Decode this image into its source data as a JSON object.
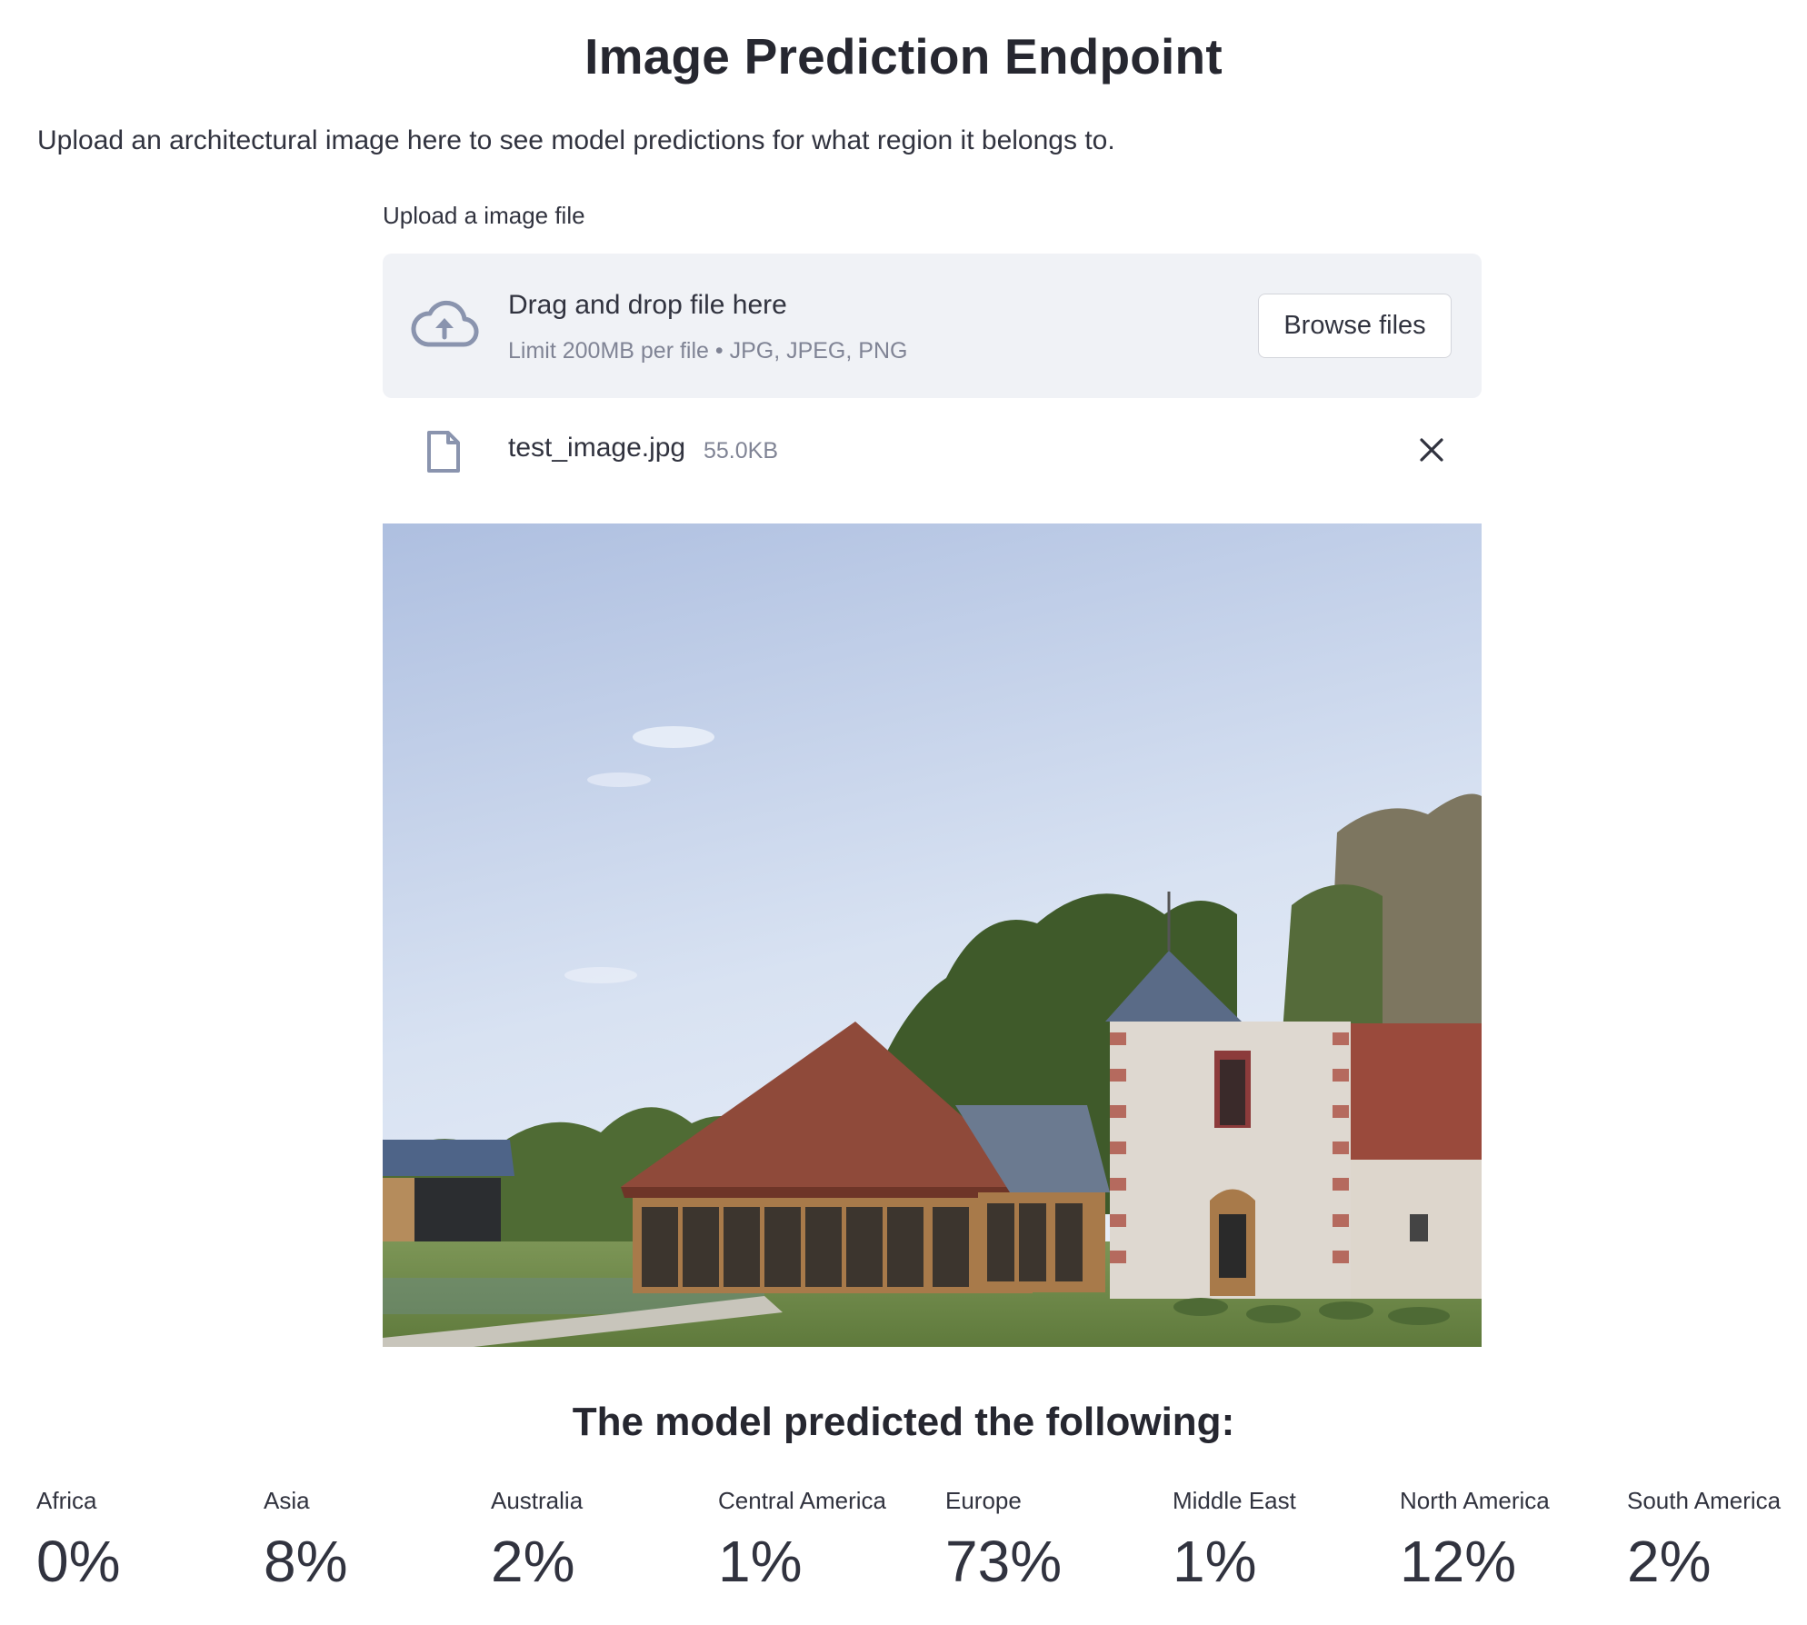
{
  "page": {
    "title": "Image Prediction Endpoint",
    "intro": "Upload an architectural image here to see model predictions for what region it belongs to."
  },
  "uploader": {
    "label": "Upload a image file",
    "drag_text": "Drag and drop file here",
    "limit_text": "Limit 200MB per file • JPG, JPEG, PNG",
    "browse_label": "Browse files",
    "icon": "cloud-upload-icon"
  },
  "uploaded_file": {
    "name": "test_image.jpg",
    "size": "55.0KB",
    "icon": "file-icon",
    "remove_icon": "close-icon"
  },
  "results": {
    "heading": "The model predicted the following:",
    "metrics": [
      {
        "label": "Africa",
        "value": "0%"
      },
      {
        "label": "Asia",
        "value": "8%"
      },
      {
        "label": "Australia",
        "value": "2%"
      },
      {
        "label": "Central America",
        "value": "1%"
      },
      {
        "label": "Europe",
        "value": "73%"
      },
      {
        "label": "Middle East",
        "value": "1%"
      },
      {
        "label": "North America",
        "value": "12%"
      },
      {
        "label": "South America",
        "value": "2%"
      }
    ]
  },
  "colors": {
    "text": "#31333f",
    "muted": "#808495",
    "dropzone_bg": "#f0f2f6",
    "icon": "#8a94ae"
  }
}
